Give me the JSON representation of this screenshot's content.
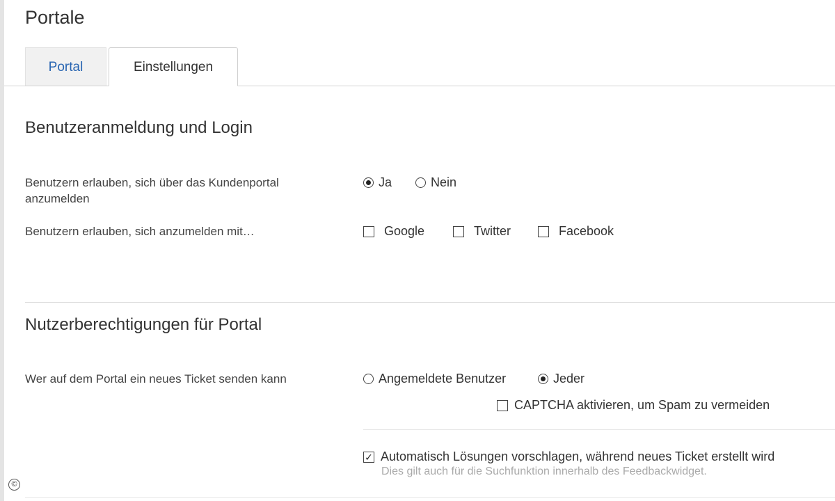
{
  "page": {
    "title": "Portale"
  },
  "tabs": [
    {
      "label": "Portal",
      "active": false
    },
    {
      "label": "Einstellungen",
      "active": true
    }
  ],
  "section_login": {
    "title": "Benutzeranmeldung und Login",
    "allow_portal_login": {
      "label": "Benutzern erlauben, sich über das Kundenportal anzumelden",
      "options": [
        {
          "label": "Ja",
          "selected": true
        },
        {
          "label": "Nein",
          "selected": false
        }
      ]
    },
    "allow_login_with": {
      "label": "Benutzern erlauben, sich anzumelden mit…",
      "options": [
        {
          "label": "Google",
          "checked": false
        },
        {
          "label": "Twitter",
          "checked": false
        },
        {
          "label": "Facebook",
          "checked": false
        }
      ]
    }
  },
  "section_permissions": {
    "title": "Nutzerberechtigungen für Portal",
    "new_ticket": {
      "label": "Wer auf dem Portal ein neues Ticket senden kann",
      "options": [
        {
          "label": "Angemeldete Benutzer",
          "selected": false
        },
        {
          "label": "Jeder",
          "selected": true
        }
      ],
      "captcha": {
        "label": "CAPTCHA aktivieren, um Spam zu vermeiden",
        "checked": false
      }
    },
    "auto_suggest": {
      "label": "Automatisch Lösungen vorschlagen, während neues Ticket erstellt wird",
      "checked": true,
      "hint": "Dies gilt auch für die Suchfunktion innerhalb des Feedbackwidget."
    }
  },
  "footer": {
    "copyright_symbol": "©"
  }
}
